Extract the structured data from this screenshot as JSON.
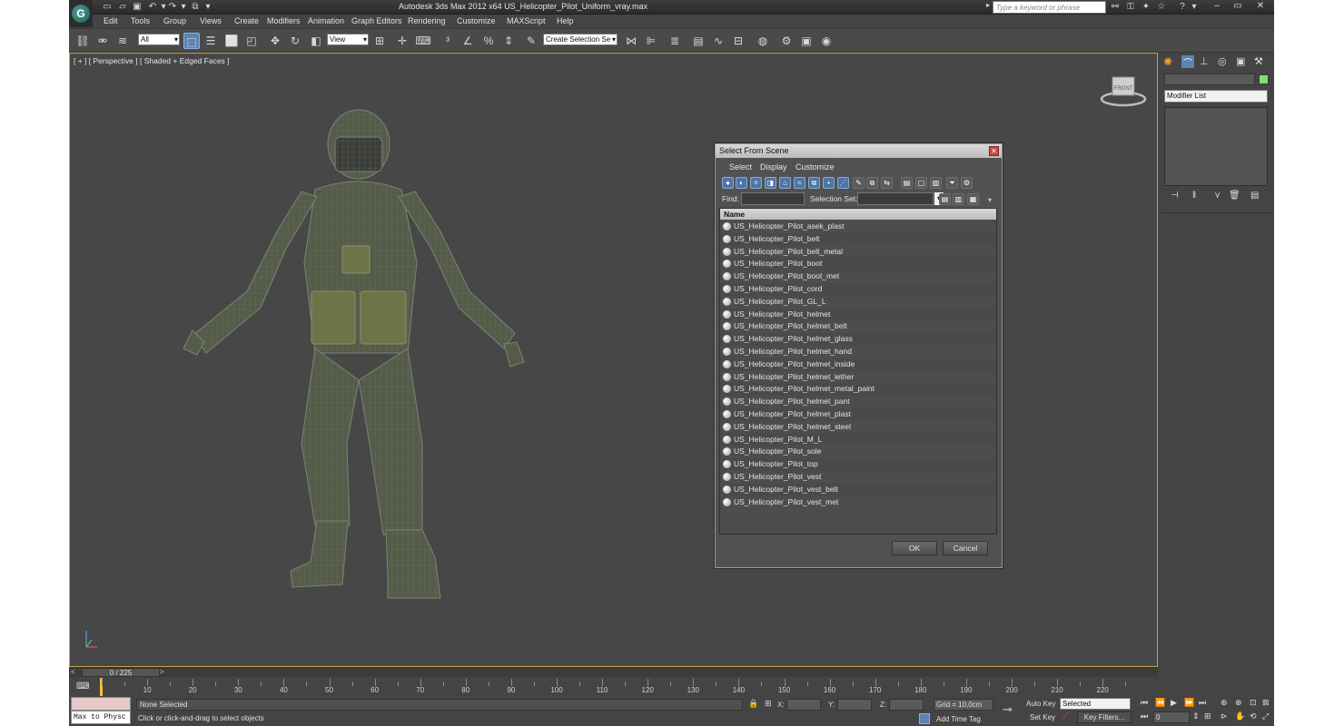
{
  "title_bar": {
    "title": "Autodesk 3ds Max  2012 x64      US_Helicopter_Pilot_Uniform_vray.max",
    "search_placeholder": "Type a keyword or phrase"
  },
  "menu": [
    "Edit",
    "Tools",
    "Group",
    "Views",
    "Create",
    "Modifiers",
    "Animation",
    "Graph Editors",
    "Rendering",
    "Customize",
    "MAXScript",
    "Help"
  ],
  "toolbar": {
    "selection_filter": "All",
    "reference_coord": "View",
    "named_selection": "Create Selection Se"
  },
  "viewport": {
    "label": "[ + ] [ Perspective ] [ Shaded + Edged Faces ]",
    "viewcube_label": "FRONT"
  },
  "command_panel": {
    "modifier_list": "Modifier List"
  },
  "dialog": {
    "title": "Select From Scene",
    "menu": [
      "Select",
      "Display",
      "Customize"
    ],
    "find_label": "Find:",
    "selection_set_label": "Selection Set:",
    "column_name": "Name",
    "objects": [
      "US_Helicopter_Pilot_asek_plast",
      "US_Helicopter_Pilot_belt",
      "US_Helicopter_Pilot_belt_metal",
      "US_Helicopter_Pilot_boot",
      "US_Helicopter_Pilot_boot_met",
      "US_Helicopter_Pilot_cord",
      "US_Helicopter_Pilot_GL_L",
      "US_Helicopter_Pilot_helmet",
      "US_Helicopter_Pilot_helmet_belt",
      "US_Helicopter_Pilot_helmet_glass",
      "US_Helicopter_Pilot_helmet_hand",
      "US_Helicopter_Pilot_helmet_inside",
      "US_Helicopter_Pilot_helmet_lether",
      "US_Helicopter_Pilot_helmet_metal_paint",
      "US_Helicopter_Pilot_helmet_pant",
      "US_Helicopter_Pilot_helmet_plast",
      "US_Helicopter_Pilot_helmet_steel",
      "US_Helicopter_Pilot_M_L",
      "US_Helicopter_Pilot_sole",
      "US_Helicopter_Pilot_top",
      "US_Helicopter_Pilot_vest",
      "US_Helicopter_Pilot_vest_belt",
      "US_Helicopter_Pilot_vest_met"
    ],
    "ok_label": "OK",
    "cancel_label": "Cancel"
  },
  "timeline": {
    "frame": "0 / 225",
    "ticks": [
      "10",
      "20",
      "30",
      "40",
      "50",
      "60",
      "70",
      "80",
      "90",
      "100",
      "110",
      "120",
      "130",
      "140",
      "150",
      "160",
      "170",
      "180",
      "190",
      "200",
      "210",
      "220"
    ]
  },
  "status": {
    "script_listener": "Max to Physc",
    "selection": "None Selected",
    "prompt": "Click or click-and-drag to select objects",
    "x_label": "X:",
    "y_label": "Y:",
    "z_label": "Z:",
    "grid": "Grid = 10,0cm",
    "add_time_tag": "Add Time Tag",
    "auto_key": "Auto Key",
    "set_key": "Set Key",
    "key_mode": "Selected",
    "key_filters": "Key Filters...",
    "current_frame": "0"
  }
}
